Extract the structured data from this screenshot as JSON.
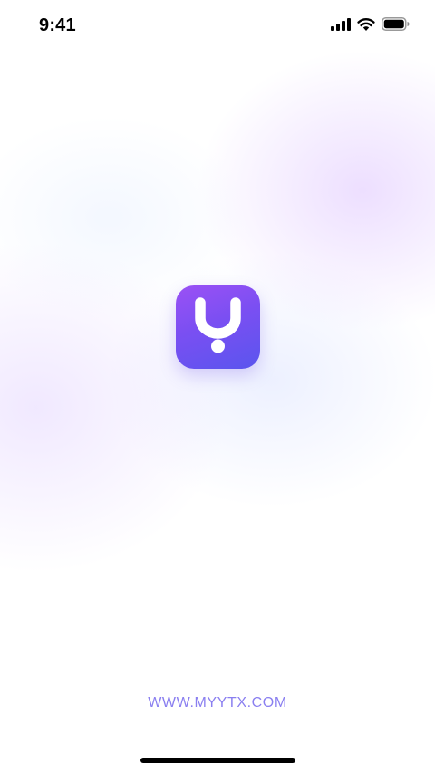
{
  "status_bar": {
    "time": "9:41",
    "icons": [
      "cellular-signal-icon",
      "wifi-icon",
      "battery-icon"
    ]
  },
  "splash": {
    "logo_icon": "app-logo-icon",
    "website": "WWW.MYYTX.COM"
  },
  "colors": {
    "logo_gradient_start": "#9b51f5",
    "logo_gradient_end": "#5a55ee",
    "website_text": "#8a7ff0",
    "home_indicator": "#000000"
  }
}
